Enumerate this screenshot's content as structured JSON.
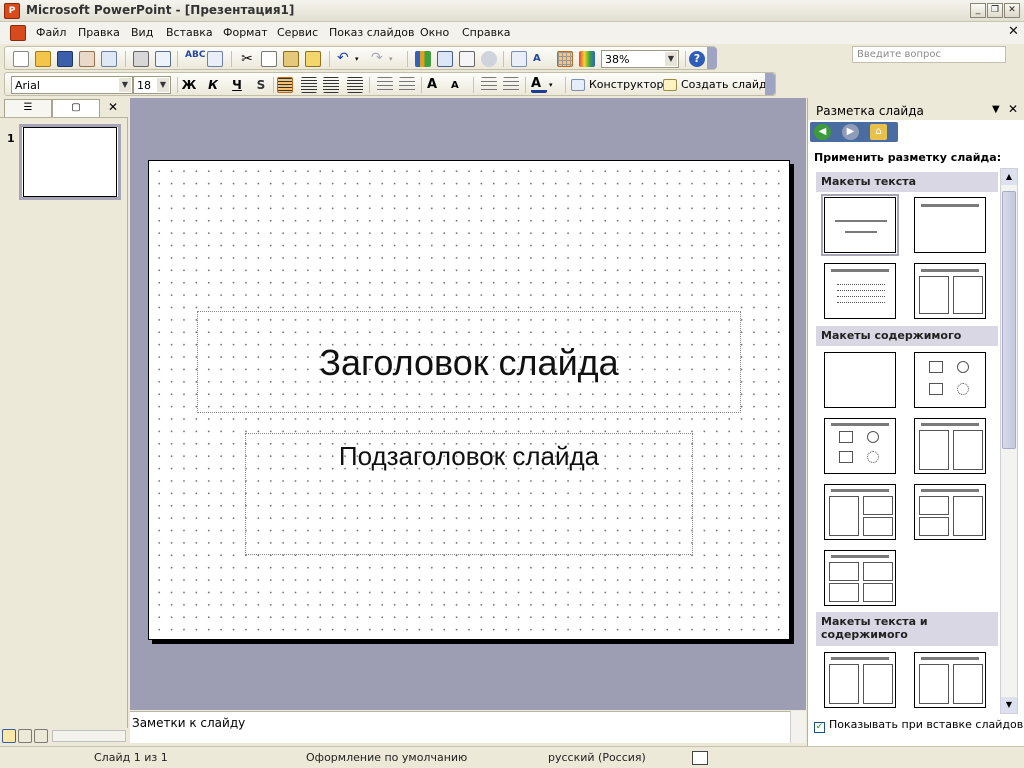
{
  "window": {
    "title": "Microsoft PowerPoint - [Презентация1]"
  },
  "menu": [
    "Файл",
    "Правка",
    "Вид",
    "Вставка",
    "Формат",
    "Сервис",
    "Показ слайдов",
    "Окно",
    "Справка"
  ],
  "help_placeholder": "Введите вопрос",
  "toolbar": {
    "zoom": "38%"
  },
  "format_bar": {
    "font": "Arial",
    "size": "18",
    "bold": "Ж",
    "italic": "К",
    "underline": "Ч",
    "shadow": "S",
    "designer": "Конструктор",
    "new_slide": "Создать слайд"
  },
  "thumbs": {
    "number": "1"
  },
  "slide": {
    "title": "Заголовок слайда",
    "subtitle": "Подзаголовок слайда"
  },
  "notes": {
    "placeholder": "Заметки к слайду"
  },
  "status": {
    "slide": "Слайд 1 из 1",
    "design": "Оформление по умолчанию",
    "language": "русский (Россия)"
  },
  "taskpane": {
    "title": "Разметка слайда",
    "apply": "Применить разметку слайда:",
    "groups": [
      "Макеты текста",
      "Макеты содержимого",
      "Макеты текста и содержимого"
    ],
    "show_on_insert": "Показывать при вставке слайдов"
  }
}
